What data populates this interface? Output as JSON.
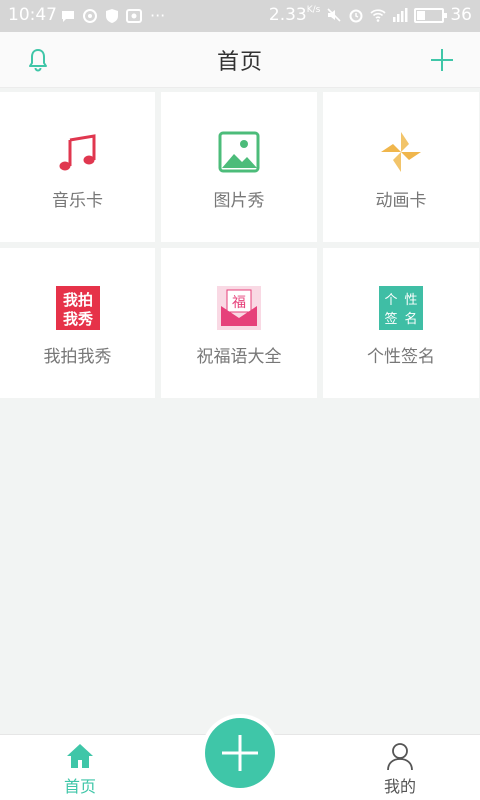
{
  "status_bar": {
    "time": "10:47",
    "network_speed": "2.33",
    "speed_unit": "K/s",
    "battery": "36"
  },
  "header": {
    "title": "首页"
  },
  "tiles": [
    {
      "label": "音乐卡",
      "icon": "music-note-icon",
      "color": "#e0374f"
    },
    {
      "label": "图片秀",
      "icon": "image-icon",
      "color": "#4cbc7a"
    },
    {
      "label": "动画卡",
      "icon": "pinwheel-icon",
      "color": "#f2c46a"
    },
    {
      "label": "我拍我秀",
      "icon": "wopaiwoxiu-logo-icon",
      "color": "#e63249",
      "icon_text": "我拍我秀"
    },
    {
      "label": "祝福语大全",
      "icon": "blessing-envelope-icon",
      "color": "#e6407a",
      "icon_text": "福"
    },
    {
      "label": "个性签名",
      "icon": "signature-logo-icon",
      "color": "#3fbea5",
      "icon_text": "个性签名"
    }
  ],
  "bottom_nav": {
    "home_label": "首页",
    "mine_label": "我的",
    "active": "home",
    "accent": "#3fc6a8"
  }
}
